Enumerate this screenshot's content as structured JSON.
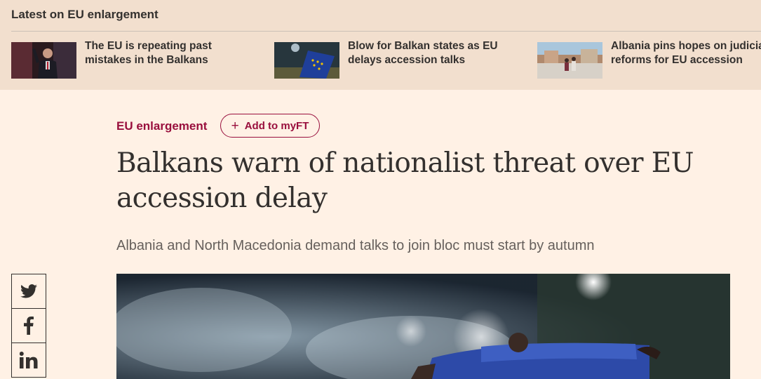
{
  "latest": {
    "heading": "Latest on EU enlargement",
    "items": [
      {
        "headline": "The EU is repeating past mistakes in the Balkans",
        "thumb_icon": "politician-photo"
      },
      {
        "headline": "Blow for Balkan states as EU delays accession talks",
        "thumb_icon": "eu-flag-photo"
      },
      {
        "headline": "Albania pins hopes on judicial reforms for EU accession",
        "thumb_icon": "square-protest-photo"
      }
    ]
  },
  "article": {
    "topic": "EU enlargement",
    "myft_label": "Add to myFT",
    "headline": "Balkans warn of nationalist threat over EU accession delay",
    "standfirst": "Albania and North Macedonia demand talks to join bloc must start by autumn"
  },
  "share": {
    "twitter_icon": "twitter-icon",
    "facebook_icon": "facebook-icon",
    "linkedin_icon": "linkedin-icon"
  },
  "colors": {
    "page_background": "#fff1e5",
    "latest_bar_background": "#f2dfce",
    "accent": "#990f3d",
    "text": "#33302e",
    "muted_text": "#66605c"
  }
}
